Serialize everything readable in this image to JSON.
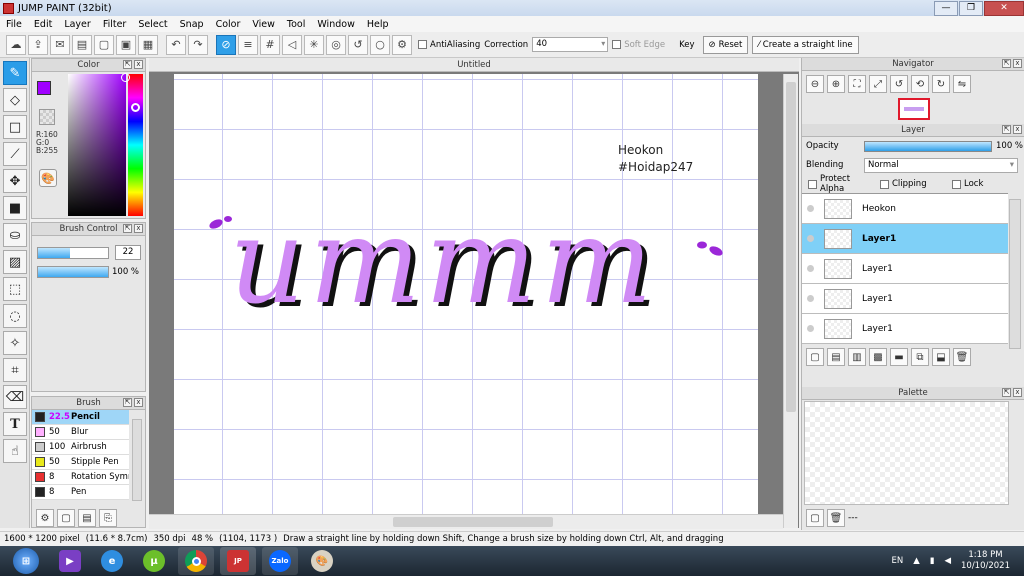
{
  "window": {
    "title": "JUMP PAINT (32bit)",
    "min": "—",
    "max": "❐",
    "close": "✕"
  },
  "menu": [
    "File",
    "Edit",
    "Layer",
    "Filter",
    "Select",
    "Snap",
    "Color",
    "View",
    "Tool",
    "Window",
    "Help"
  ],
  "toolbar": {
    "antialiasing": "AntiAliasing",
    "correction_label": "Correction",
    "correction_value": "40",
    "soft_edge": "Soft Edge",
    "key": "Key",
    "reset": "Reset",
    "straight_line": "Create a straight line"
  },
  "color_panel": {
    "title": "Color",
    "r": "R:160",
    "g": "G:0",
    "b": "B:255",
    "fg": "#a000ff",
    "bg": "#ffffff"
  },
  "brush_control": {
    "title": "Brush Control",
    "size": "22",
    "opacity": "100 %",
    "size_fraction": 0.45,
    "opacity_fraction": 1.0
  },
  "brush_panel": {
    "title": "Brush",
    "items": [
      {
        "size": "22.5",
        "name": "Pencil",
        "color": "#222222"
      },
      {
        "size": "50",
        "name": "Blur",
        "color": "#ffb0ff"
      },
      {
        "size": "100",
        "name": "Airbrush",
        "color": "#cccccc"
      },
      {
        "size": "50",
        "name": "Stipple Pen",
        "color": "#e8e81a"
      },
      {
        "size": "8",
        "name": "Rotation Symm",
        "color": "#e83030"
      },
      {
        "size": "8",
        "name": "Pen",
        "color": "#222222"
      }
    ]
  },
  "document": {
    "tab": "Untitled",
    "text_line1": "Heokon",
    "text_line2": "#Hoidap247",
    "artwork_word": "ummm"
  },
  "navigator": {
    "title": "Navigator"
  },
  "layer_panel": {
    "title": "Layer",
    "opacity_label": "Opacity",
    "opacity_value": "100 %",
    "blending_label": "Blending",
    "blending_value": "Normal",
    "protect_alpha": "Protect Alpha",
    "clipping": "Clipping",
    "lock": "Lock",
    "layers": [
      {
        "name": "Heokon",
        "selected": false
      },
      {
        "name": "Layer1",
        "selected": true
      },
      {
        "name": "Layer1",
        "selected": false
      },
      {
        "name": "Layer1",
        "selected": false
      },
      {
        "name": "Layer1",
        "selected": false
      }
    ]
  },
  "palette": {
    "title": "Palette",
    "dash": "---"
  },
  "status": {
    "size": "1600 * 1200 pixel",
    "cm": "(11.6 * 8.7cm)",
    "dpi": "350 dpi",
    "zoom": "48 %",
    "coords": "(1104, 1173 )",
    "hint": "Draw a straight line by holding down Shift, Change a brush size by holding down Ctrl, Alt, and dragging"
  },
  "taskbar": {
    "lang": "EN",
    "time": "1:18 PM",
    "date": "10/10/2021",
    "apps": [
      "visual-studio",
      "ie",
      "utorrent",
      "chrome",
      "jump-paint",
      "zalo",
      "paint-palette"
    ]
  }
}
